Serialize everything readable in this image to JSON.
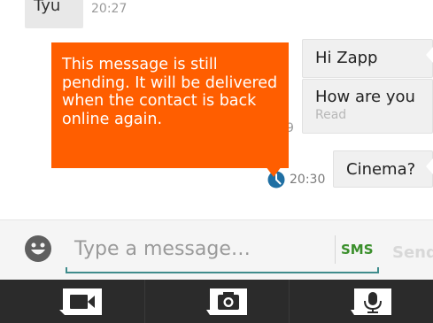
{
  "messages": {
    "incoming_partial": {
      "text": "Tyu",
      "time": "20:27"
    },
    "outgoing": [
      {
        "text": "Hi Zapp"
      },
      {
        "text": "How are you",
        "status": "Read"
      },
      {
        "text": "Cinema?",
        "time": "20:30"
      }
    ],
    "hidden_time_fragment": "9"
  },
  "tooltip": {
    "text": "This message is still pending. It will be delivered when the contact is back online again.",
    "color": "#ff5e00"
  },
  "composer": {
    "placeholder": "Type a message…",
    "mode_badge": "SMS",
    "send_label": "Send"
  },
  "action_bar": {
    "items": [
      "video-icon",
      "camera-icon",
      "microphone-icon"
    ]
  },
  "colors": {
    "accent_green": "#3a8f2b",
    "underline_teal": "#3f8c8c",
    "clock_blue": "#1f6fa3",
    "bar_bg": "#2b2b2b"
  }
}
